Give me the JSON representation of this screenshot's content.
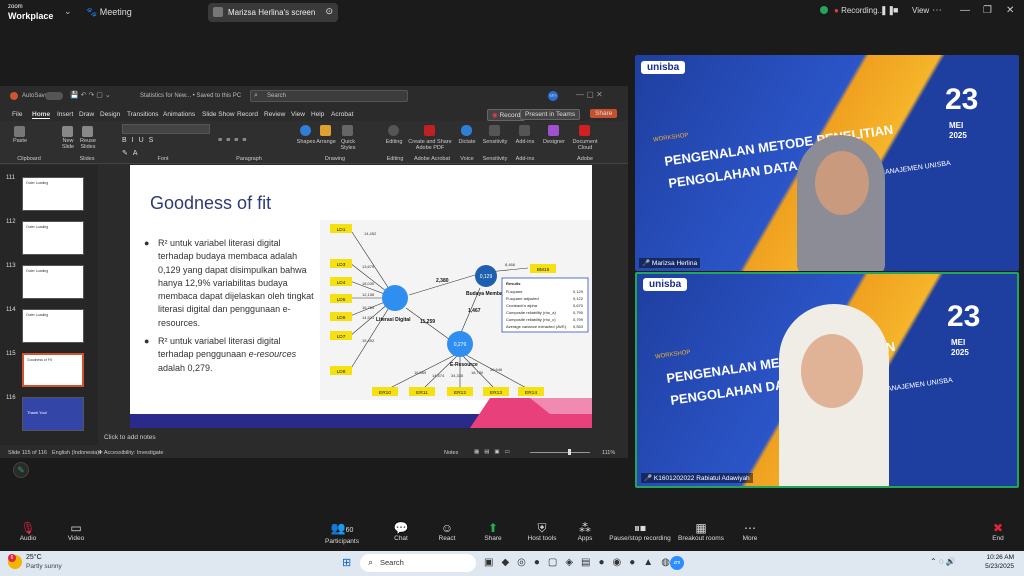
{
  "zoom": {
    "logo_top": "zoom",
    "logo_bottom": "Workplace",
    "meeting_label": "Meeting",
    "share_label": "Marizsa Herlina's screen",
    "recording_label": "Recording...",
    "view_label": "View"
  },
  "ppt": {
    "autosave": "AutoSave",
    "doc_title": "Statistics for New... • Saved to this PC",
    "search_placeholder": "Search",
    "user_initials": "MH",
    "menu": [
      "File",
      "Home",
      "Insert",
      "Draw",
      "Design",
      "Transitions",
      "Animations",
      "Slide Show",
      "Record",
      "Review",
      "View",
      "Help",
      "Acrobat"
    ],
    "record_btn": "Record",
    "present_btn": "Present in Teams",
    "share_btn": "Share",
    "ribbon_groups": [
      "Clipboard",
      "Slides",
      "Font",
      "Paragraph",
      "Drawing",
      "Editing",
      "Adobe Acrobat",
      "Voice",
      "Sensitivity",
      "Add-ins"
    ],
    "ribbon_buttons": {
      "paste": "Paste",
      "new_slide": "New Slide",
      "reuse": "Reuse Slides",
      "shapes": "Shapes",
      "arrange": "Arrange",
      "quick": "Quick Styles",
      "editing": "Editing",
      "create_pdf": "Create and Share Adobe PDF",
      "dictate": "Dictate",
      "sensitivity": "Sensitivity",
      "addins": "Add-ins",
      "designer": "Designer",
      "doc_cloud": "Document Cloud",
      "adobe": "Adobe"
    },
    "thumbnails": [
      {
        "num": "111",
        "title": "Outer Loading"
      },
      {
        "num": "112",
        "title": "Outer Loading"
      },
      {
        "num": "113",
        "title": "Outer Loading"
      },
      {
        "num": "114",
        "title": "Outer Loading"
      },
      {
        "num": "115",
        "title": "Goodness of Fit"
      },
      {
        "num": "116",
        "title": "Thank You!"
      }
    ],
    "slide": {
      "title": "Goodness of fit",
      "bullet1": "R² untuk variabel literasi digital terhadap budaya membaca adalah 0,129 yang dapat disimpulkan bahwa hanya 12,9% variabilitas budaya membaca dapat dijelaskan oleh tingkat literasi digital dan penggunaan e-resources.",
      "bullet2_pre": "R² untuk variabel literasi digital terhadap penggunaan ",
      "bullet2_em": "e-resources",
      "bullet2_post": " adalah 0,279.",
      "diagram": {
        "indicators_ld": [
          "LD1",
          "LD3",
          "LD4",
          "LD5",
          "LD6",
          "LD7",
          "LD8"
        ],
        "ld_loadings": [
          "14,452",
          "13,679",
          "18,030",
          "12,158",
          "16,765",
          "14,521",
          "15,452"
        ],
        "er_indicators": [
          "ER10",
          "ER11",
          "ER12",
          "ER13",
          "ER14"
        ],
        "er_loadings": [
          "16,569",
          "14,574",
          "34,335",
          "18,730",
          "30,646"
        ],
        "bm": "BM16",
        "bm_loading": "8,466",
        "node_ld": "Literasi Digital",
        "node_bm": "Budaya Membaca",
        "node_er": "E-Resource",
        "bm_r2": "0,129",
        "er_r2": "0,279",
        "path_ld_bm": "2,380",
        "path_ld_er": "11,259",
        "path_er_bm": "1,467",
        "results_title": "Results",
        "results": [
          [
            "R-square",
            "0,129"
          ],
          [
            "R-square adjusted",
            "0,122"
          ],
          [
            "Cronbach's alpha",
            "0,670"
          ],
          [
            "Composite reliability (rho_a)",
            "0,790"
          ],
          [
            "Composite reliability (rho_c)",
            "0,799"
          ],
          [
            "Average variance extracted (AVE)",
            "0,553"
          ]
        ]
      }
    },
    "notes_placeholder": "Click to add notes",
    "status": {
      "slide": "Slide 115 of 116",
      "lang": "English (Indonesia)",
      "access": "Accessibility: Investigate",
      "notes": "Notes",
      "zoom": "111%"
    }
  },
  "tiles": [
    {
      "name": "Marizsa Herlina",
      "brand": "unisba",
      "workshop": "WORKSHOP",
      "line1": "PENGENALAN METODE PENELITIAN",
      "line2": "PENGOLAHAN DATA",
      "sub": "MANAJEMEN UNISBA",
      "day": "23",
      "month": "MEI",
      "year": "2025"
    },
    {
      "name": "K1601202022 Rabiatul Adawiyah",
      "brand": "unisba",
      "workshop": "WORKSHOP",
      "line1": "PENGENALAN METODE PENELITIAN",
      "line2": "PENGOLAHAN DATA",
      "sub": "MANAJEMEN UNISBA",
      "day": "23",
      "month": "MEI",
      "year": "2025"
    }
  ],
  "toolbar": {
    "audio": "Audio",
    "video": "Video",
    "participants": "Participants",
    "participants_count": "60",
    "chat": "Chat",
    "react": "React",
    "share": "Share",
    "host_tools": "Host tools",
    "apps": "Apps",
    "pause_rec": "Pause/stop recording",
    "breakout": "Breakout rooms",
    "more": "More",
    "end": "End"
  },
  "taskbar": {
    "temp": "25°C",
    "weather": "Partly sunny",
    "search": "Search",
    "time": "10:26 AM",
    "date": "5/23/2025",
    "badge": "6"
  },
  "colors": {
    "accent_green": "#23a55a",
    "share_green": "#1fb050",
    "end_red": "#e0253a",
    "slide_title": "#2e3a75",
    "node_blue": "#2f8ff0"
  }
}
